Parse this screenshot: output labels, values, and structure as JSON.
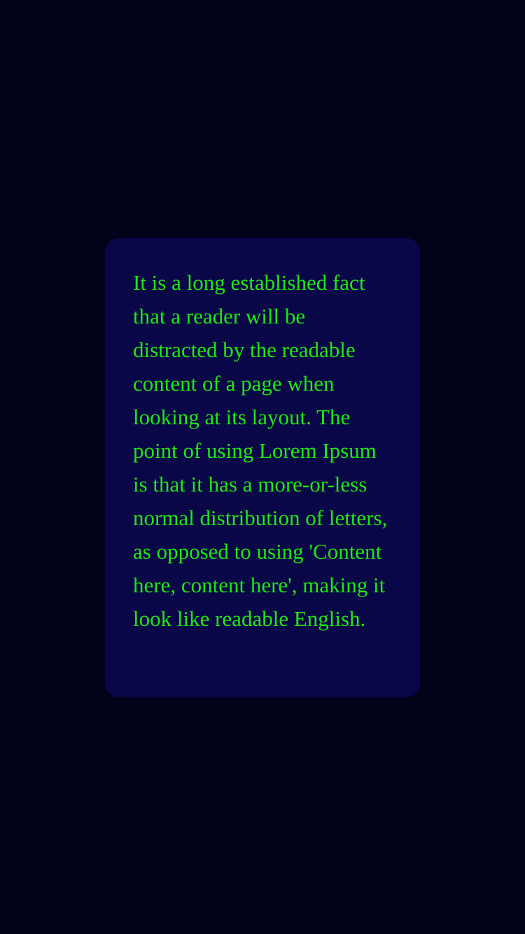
{
  "card": {
    "text": "It is a long established fact that a reader will be distracted by the readable content of a page when looking at its layout. The point of using Lorem Ipsum is that it has a more-or-less normal distribution of letters, as opposed to using 'Content here, content here', making it look like readable English."
  },
  "colors": {
    "background": "#02021a",
    "card_background": "#0a0748",
    "text": "#1de812"
  }
}
